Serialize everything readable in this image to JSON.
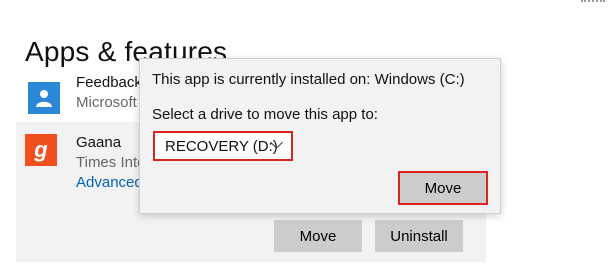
{
  "page": {
    "heading": "Apps & features"
  },
  "apps": [
    {
      "name": "Feedback",
      "publisher": "Microsoft",
      "icon": "feedback-hub-icon",
      "icon_color": "#2b88d8"
    },
    {
      "name": "Gaana",
      "publisher": "Times Inte",
      "link": "Advanced",
      "icon": "gaana-icon",
      "icon_glyph": "g",
      "icon_color": "#f0501e"
    }
  ],
  "app_actions": {
    "move_label": "Move",
    "uninstall_label": "Uninstall"
  },
  "move_flyout": {
    "installed_on": "This app is currently installed on: Windows (C:)",
    "select_prompt": "Select a drive to move this app to:",
    "selected_drive": "RECOVERY (D:)",
    "move_label": "Move"
  },
  "colors": {
    "highlight": "#d9251d",
    "link": "#0063b1",
    "button_bg": "#cccccc"
  }
}
